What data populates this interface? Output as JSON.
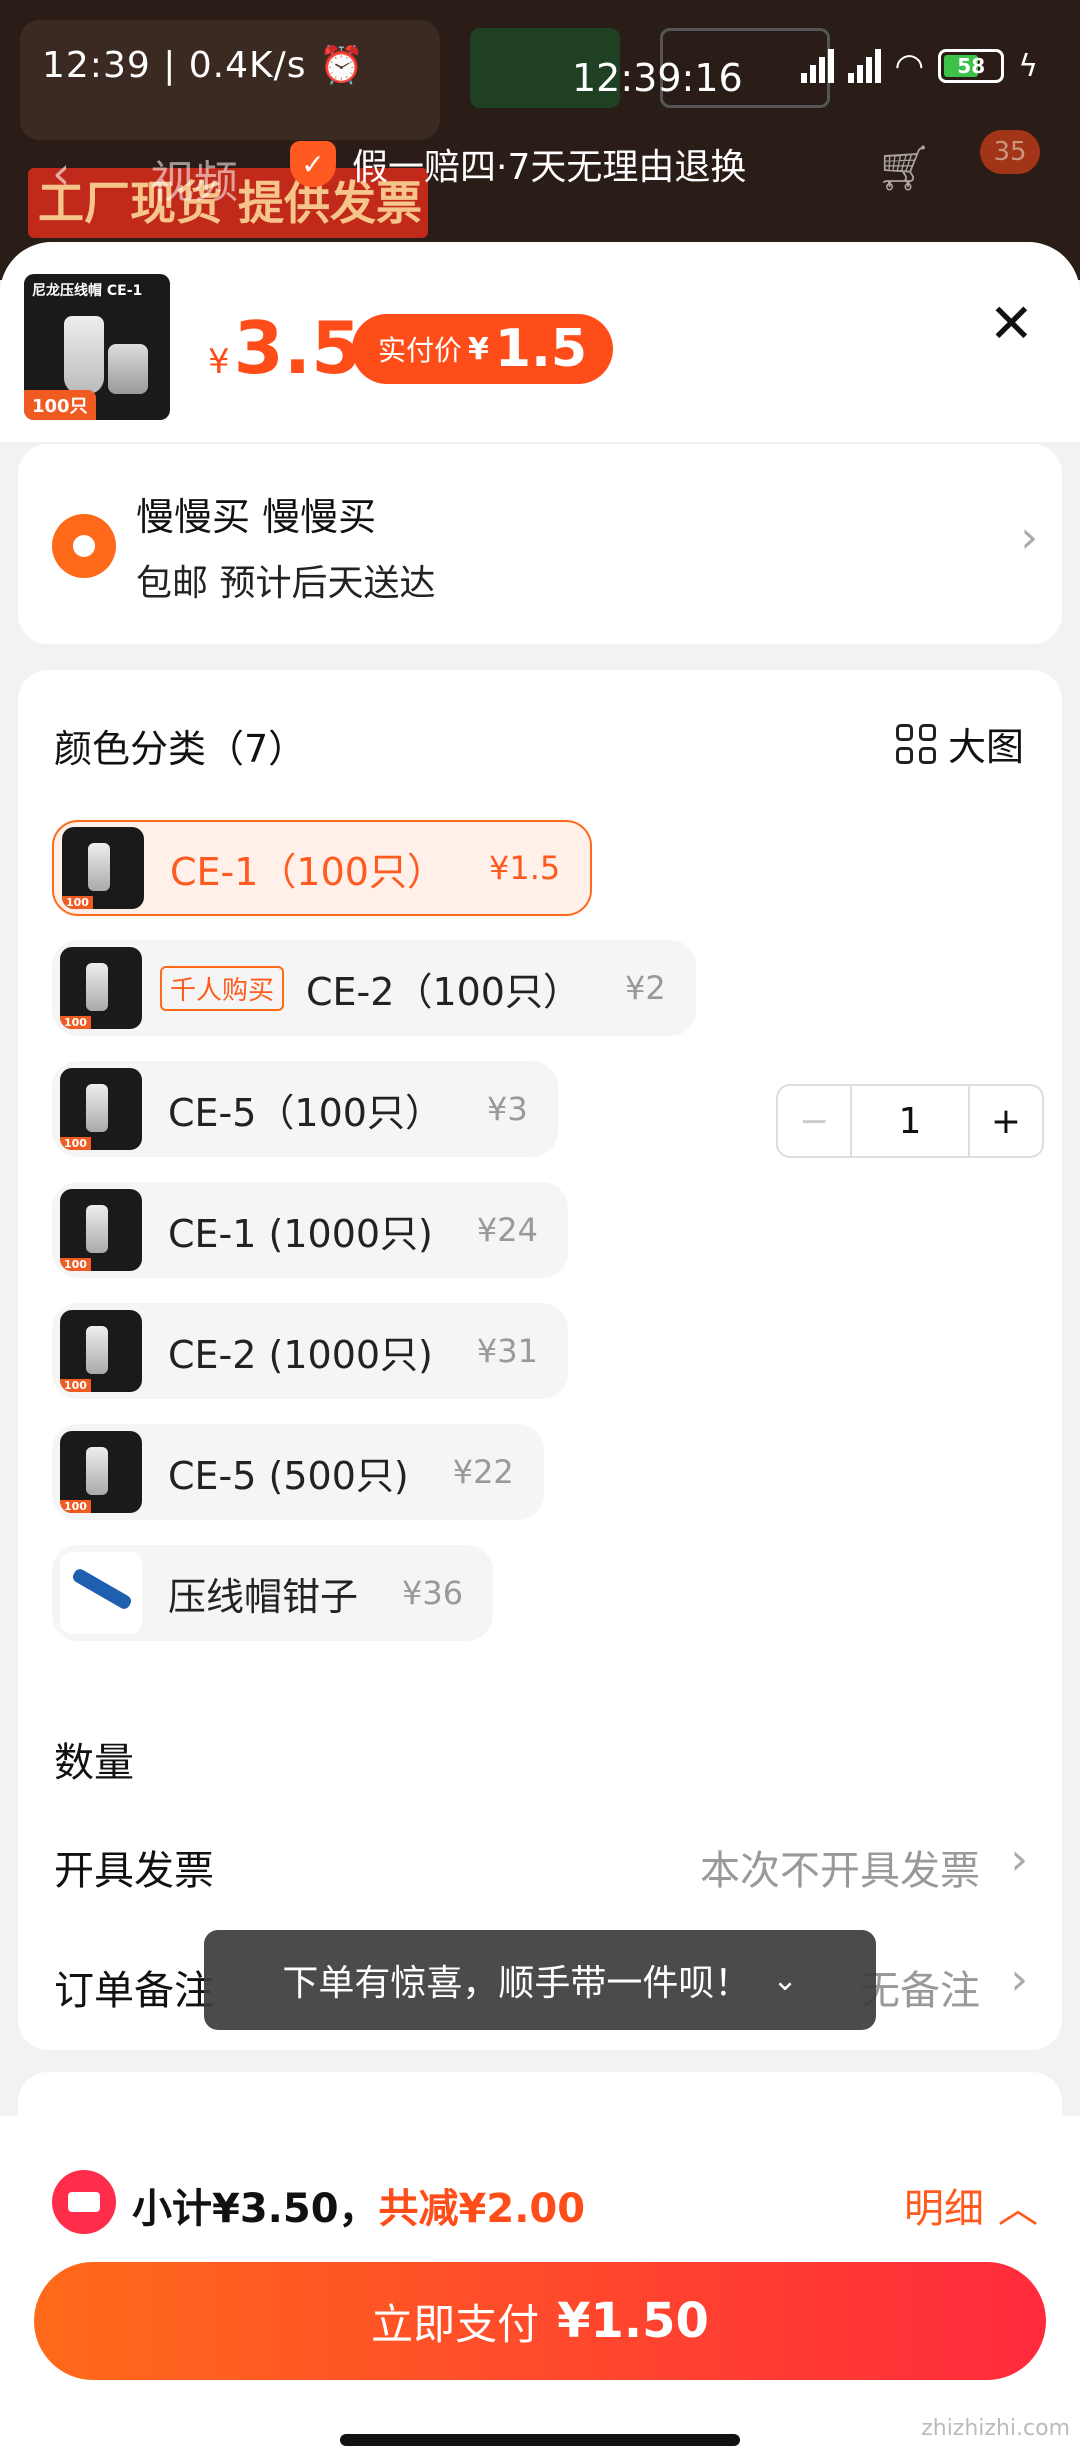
{
  "background": {
    "video_label": "视频",
    "banner_text": "工厂现货 提供发票"
  },
  "status_bar": {
    "time": "12:39",
    "network_speed": "0.4K/s",
    "clock": "12:39:16",
    "battery": "58"
  },
  "nav": {
    "guarantee_text": "假一赔四·7天无理由退换",
    "cart_badge": "35"
  },
  "product": {
    "thumb_title": "尼龙压线帽 CE-1",
    "thumb_tag": "100只",
    "currency": "¥",
    "price": "3.5",
    "paid_label": "实付价",
    "paid_price": "1.5"
  },
  "address": {
    "name": "慢慢买 慢慢买",
    "shipping": "包邮 预计后天送达"
  },
  "options": {
    "title": "颜色分类（7）",
    "big_view_label": "大图",
    "items": [
      {
        "name": "CE-1（100只）",
        "price": "¥1.5",
        "selected": true,
        "tag": ""
      },
      {
        "name": "CE-2（100只）",
        "price": "¥2",
        "selected": false,
        "tag": "千人购买"
      },
      {
        "name": "CE-5（100只）",
        "price": "¥3",
        "selected": false,
        "tag": ""
      },
      {
        "name": "CE-1 (1000只)",
        "price": "¥24",
        "selected": false,
        "tag": ""
      },
      {
        "name": "CE-2 (1000只)",
        "price": "¥31",
        "selected": false,
        "tag": ""
      },
      {
        "name": "CE-5 (500只)",
        "price": "¥22",
        "selected": false,
        "tag": ""
      },
      {
        "name": "压线帽钳子",
        "price": "¥36",
        "selected": false,
        "tag": ""
      }
    ]
  },
  "quantity": {
    "label": "数量",
    "value": "1",
    "minus": "−",
    "plus": "+"
  },
  "invoice": {
    "label": "开具发票",
    "value": "本次不开具发票"
  },
  "remark": {
    "label": "订单备注",
    "value": "无备注"
  },
  "toast": {
    "text": "下单有惊喜，顺手带一件呗！"
  },
  "footer": {
    "subtotal": "小计¥3.50，",
    "discount": "共减¥2.00",
    "detail_label": "明细",
    "pay_label": "立即支付",
    "pay_amount": "¥1.50"
  },
  "watermark": "zhizhizhi.com",
  "colors": {
    "accent": "#ff4d1a",
    "pay_gradient_start": "#ff6a1a",
    "pay_gradient_end": "#ff2a3c"
  }
}
